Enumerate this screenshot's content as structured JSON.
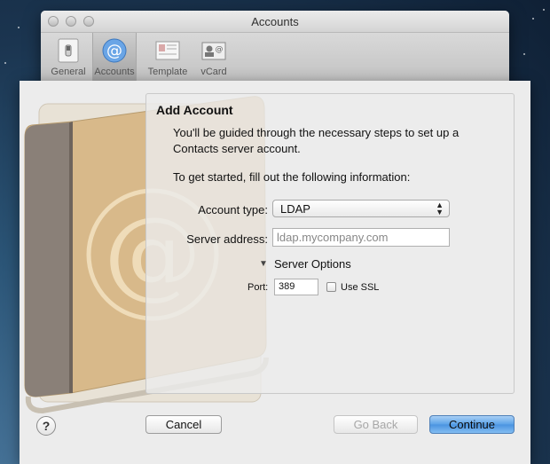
{
  "window": {
    "title": "Accounts",
    "toolbar": [
      {
        "label": "General",
        "icon": "general-switch-icon"
      },
      {
        "label": "Accounts",
        "icon": "at-sign-icon"
      },
      {
        "label": "Template",
        "icon": "template-card-icon"
      },
      {
        "label": "vCard",
        "icon": "vcard-icon"
      }
    ],
    "selected_tab": "Accounts"
  },
  "sheet": {
    "heading": "Add Account",
    "intro": "You'll be guided through the necessary steps to set up a Contacts server account.",
    "fill_out": "To get started, fill out the following information:",
    "account_type": {
      "label": "Account type:",
      "value": "LDAP"
    },
    "server_address": {
      "label": "Server address:",
      "placeholder": "ldap.mycompany.com",
      "value": ""
    },
    "server_options": {
      "label": "Server Options",
      "expanded": true,
      "port": {
        "label": "Port:",
        "value": "389"
      },
      "use_ssl": {
        "label": "Use SSL",
        "checked": false
      }
    },
    "buttons": {
      "help": "?",
      "cancel": "Cancel",
      "go_back": "Go Back",
      "continue": "Continue"
    }
  },
  "colors": {
    "default_button": "#5aa1e8",
    "book_cover": "#d9b98a",
    "book_spine": "#8a7f78"
  }
}
